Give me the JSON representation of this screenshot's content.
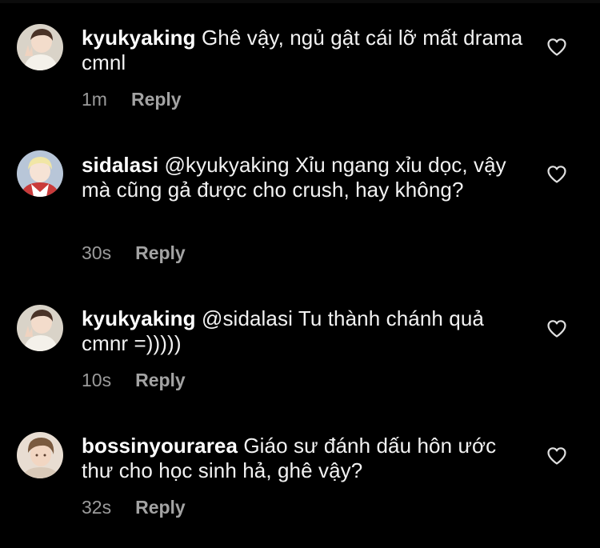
{
  "comments": [
    {
      "username": "kyukyaking",
      "text": "Ghê vậy, ngủ gật cái lỡ mất drama cmnl",
      "time": "1m",
      "reply_label": "Reply"
    },
    {
      "username": "sidalasi",
      "text": "@kyukyaking Xỉu ngang xỉu dọc, vậy mà cũng gả được cho crush, hay không?",
      "time": "30s",
      "reply_label": "Reply"
    },
    {
      "username": "kyukyaking",
      "text": "@sidalasi Tu thành chánh quả cmnr =)))))",
      "time": "10s",
      "reply_label": "Reply"
    },
    {
      "username": "bossinyourarea",
      "text": "Giáo sư đánh dấu hôn ước thư cho học sinh hả, ghê vậy?",
      "time": "32s",
      "reply_label": "Reply"
    }
  ],
  "colors": {
    "background": "#000000",
    "text": "#f2f2f2",
    "meta": "#9b9b9b",
    "heart": "#e0e0e0"
  },
  "icons": {
    "like": "heart-outline-icon"
  }
}
